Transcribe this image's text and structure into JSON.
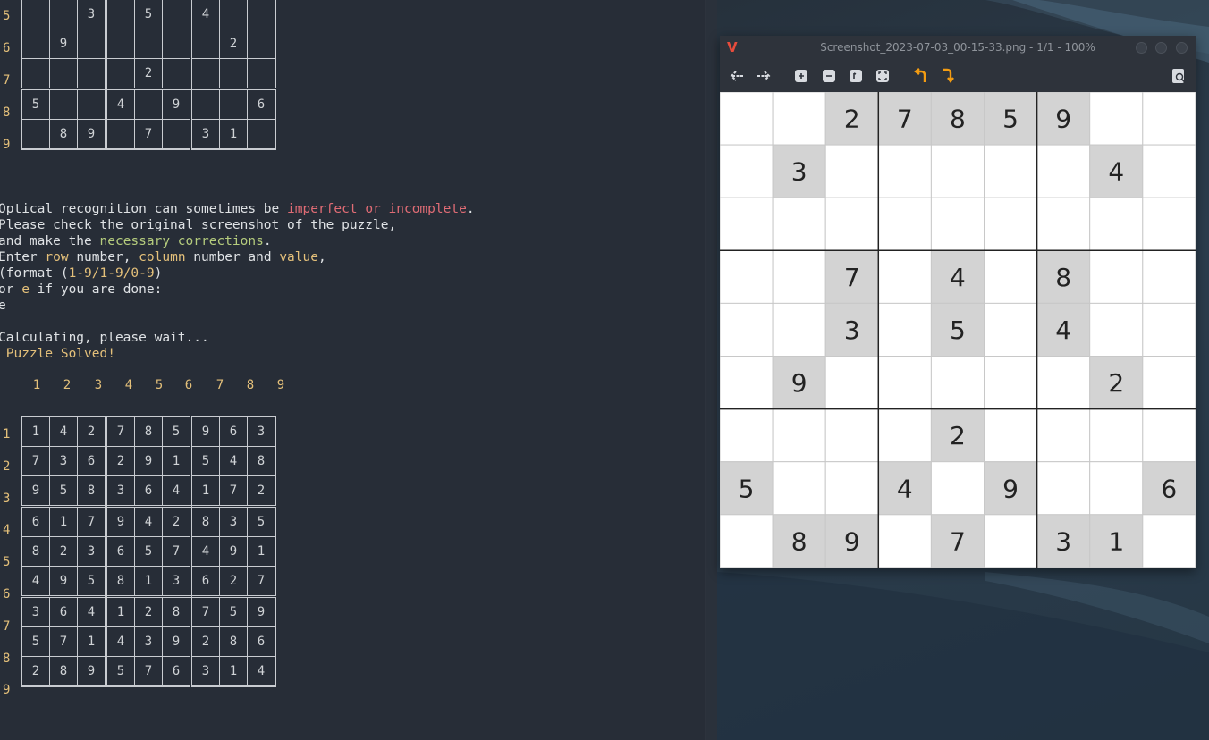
{
  "terminal": {
    "top_grid": {
      "row_labels": [
        "5",
        "6",
        "7",
        "8",
        "9"
      ],
      "rows": [
        [
          "",
          "",
          "3",
          "",
          "5",
          "",
          "4",
          "",
          ""
        ],
        [
          "",
          "9",
          "",
          "",
          "",
          "",
          "",
          "2",
          ""
        ],
        [
          "",
          "",
          "",
          "",
          "2",
          "",
          "",
          "",
          ""
        ],
        [
          "5",
          "",
          "",
          "4",
          "",
          "9",
          "",
          "",
          "6"
        ],
        [
          "",
          "8",
          "9",
          "",
          "7",
          "",
          "3",
          "1",
          ""
        ]
      ]
    },
    "messages": {
      "line1_a": "Optical recognition can sometimes be ",
      "line1_b": "imperfect or incomplete",
      "line1_c": ".",
      "line2": "Please check the original screenshot of the puzzle,",
      "line3_a": "and make the ",
      "line3_b": "necessary corrections",
      "line3_c": ".",
      "line4_a": "Enter ",
      "line4_b": "row",
      "line4_c": " number, ",
      "line4_d": "column",
      "line4_e": " number and ",
      "line4_f": "value",
      "line4_g": ",",
      "line5_a": "(format (",
      "line5_b": "1-9/1-9/0-9",
      "line5_c": ")",
      "line6_a": "or ",
      "line6_b": "e",
      "line6_c": " if you are done:",
      "line7": "e",
      "line8": "",
      "line9": "Calculating, please wait...",
      "line10": " Puzzle Solved!"
    },
    "column_labels": [
      "1",
      "2",
      "3",
      "4",
      "5",
      "6",
      "7",
      "8",
      "9"
    ],
    "solved_grid": {
      "row_labels": [
        "1",
        "2",
        "3",
        "4",
        "5",
        "6",
        "7",
        "8",
        "9"
      ],
      "rows": [
        [
          "1",
          "4",
          "2",
          "7",
          "8",
          "5",
          "9",
          "6",
          "3"
        ],
        [
          "7",
          "3",
          "6",
          "2",
          "9",
          "1",
          "5",
          "4",
          "8"
        ],
        [
          "9",
          "5",
          "8",
          "3",
          "6",
          "4",
          "1",
          "7",
          "2"
        ],
        [
          "6",
          "1",
          "7",
          "9",
          "4",
          "2",
          "8",
          "3",
          "5"
        ],
        [
          "8",
          "2",
          "3",
          "6",
          "5",
          "7",
          "4",
          "9",
          "1"
        ],
        [
          "4",
          "9",
          "5",
          "8",
          "1",
          "3",
          "6",
          "2",
          "7"
        ],
        [
          "3",
          "6",
          "4",
          "1",
          "2",
          "8",
          "7",
          "5",
          "9"
        ],
        [
          "5",
          "7",
          "1",
          "4",
          "3",
          "9",
          "2",
          "8",
          "6"
        ],
        [
          "2",
          "8",
          "9",
          "5",
          "7",
          "6",
          "3",
          "1",
          "4"
        ]
      ]
    }
  },
  "viewer": {
    "title": "Screenshot_2023-07-03_00-15-33.png - 1/1 - 100%",
    "app_icon": "V",
    "toolbar": [
      {
        "name": "back-arrow-icon",
        "glyph": "⇠"
      },
      {
        "name": "forward-arrow-icon",
        "glyph": "⇢"
      },
      {
        "name": "zoom-in-icon",
        "glyph": "⊕"
      },
      {
        "name": "zoom-out-icon",
        "glyph": "⊖"
      },
      {
        "name": "zoom-fit-icon",
        "glyph": "⊡"
      },
      {
        "name": "fullscreen-icon",
        "glyph": "⛶"
      },
      {
        "name": "rotate-left-icon",
        "glyph": "↶"
      },
      {
        "name": "rotate-right-icon",
        "glyph": "↷"
      },
      {
        "name": "image-properties-icon",
        "glyph": "🔍"
      }
    ],
    "puzzle": [
      [
        "",
        "",
        "2",
        "7",
        "8",
        "5",
        "9",
        "",
        ""
      ],
      [
        "",
        "3",
        "",
        "",
        "",
        "",
        "",
        "4",
        ""
      ],
      [
        "",
        "",
        "",
        "",
        "",
        "",
        "",
        "",
        ""
      ],
      [
        "",
        "",
        "7",
        "",
        "4",
        "",
        "8",
        "",
        ""
      ],
      [
        "",
        "",
        "3",
        "",
        "5",
        "",
        "4",
        "",
        ""
      ],
      [
        "",
        "9",
        "",
        "",
        "",
        "",
        "",
        "2",
        ""
      ],
      [
        "",
        "",
        "",
        "",
        "2",
        "",
        "",
        "",
        ""
      ],
      [
        "5",
        "",
        "",
        "4",
        "",
        "9",
        "",
        "",
        "6"
      ],
      [
        "",
        "8",
        "9",
        "",
        "7",
        "",
        "3",
        "1",
        ""
      ]
    ],
    "colors": {
      "given_cell": "#d3d3d3",
      "empty_cell": "#ffffff",
      "digit": "#222222"
    }
  }
}
